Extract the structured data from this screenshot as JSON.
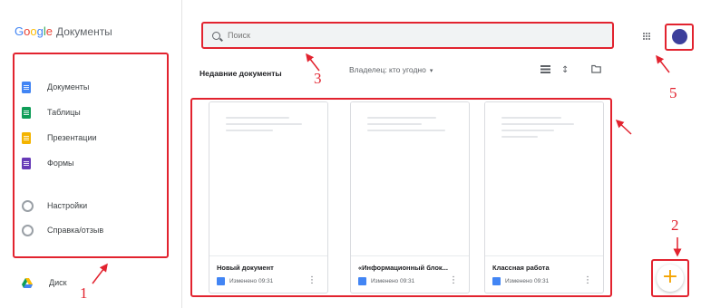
{
  "app": {
    "brand_letters": [
      "G",
      "o",
      "o",
      "g",
      "l",
      "e"
    ],
    "product": "Документы"
  },
  "sidebar": {
    "items": [
      {
        "label": "Документы",
        "icon": "docs-icon",
        "color": "#4285f4"
      },
      {
        "label": "Таблицы",
        "icon": "sheets-icon",
        "color": "#0f9d58"
      },
      {
        "label": "Презентации",
        "icon": "slides-icon",
        "color": "#f4b400"
      },
      {
        "label": "Формы",
        "icon": "forms-icon",
        "color": "#673ab7"
      },
      {
        "label": "Настройки",
        "icon": "settings-icon"
      },
      {
        "label": "Справка/отзыв",
        "icon": "help-icon"
      }
    ],
    "drive_label": "Диск"
  },
  "search": {
    "placeholder": "Поиск"
  },
  "toolbar": {
    "title": "Недавние документы",
    "owner_filter": "Владелец: кто угодно"
  },
  "documents": [
    {
      "title": "Новый документ",
      "meta": "Изменено 09:31"
    },
    {
      "title": "«Информационный блок...",
      "meta": "Изменено 09:31"
    },
    {
      "title": "Классная работа",
      "meta": "Изменено 09:31"
    }
  ],
  "fab": {
    "symbol": "+"
  },
  "annotations": {
    "sidebar": "1",
    "fab": "2",
    "search": "3",
    "avatar": "5"
  },
  "colors": {
    "highlight": "#e2232f",
    "fab_plus": "#f4a300",
    "avatar": "#3c3f9b"
  }
}
